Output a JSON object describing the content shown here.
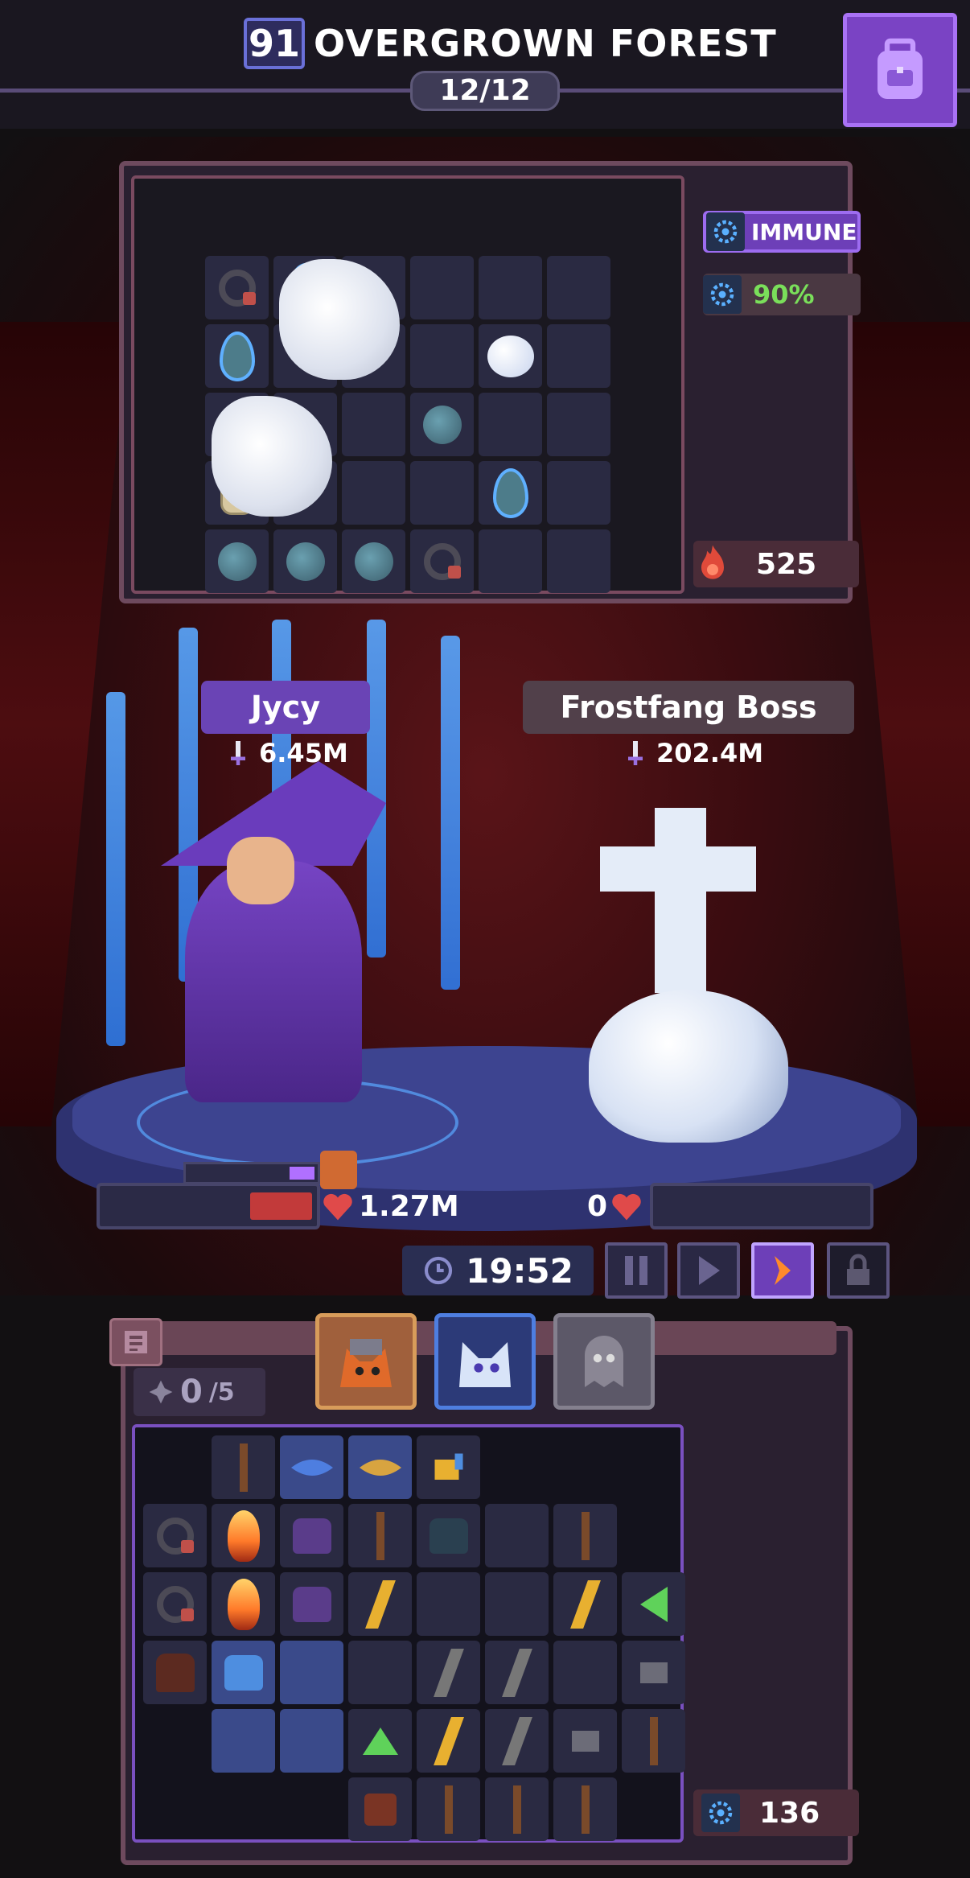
{
  "header": {
    "level": "91",
    "zone_name": "OVERGROWN FOREST",
    "wave": "12/12",
    "bag_icon": "backpack-icon"
  },
  "enemy_panel": {
    "immune_label": "IMMUNE",
    "resist_label": "90%",
    "power_value": "525"
  },
  "player": {
    "name": "Jycy",
    "power": "6.45M",
    "hp": "1.27M",
    "hp_fraction": 0.3,
    "mana_fraction": 0.2
  },
  "boss": {
    "name": "Frostfang Boss",
    "power": "202.4M",
    "hp": "0",
    "hp_fraction": 0
  },
  "controls": {
    "timer": "19:52",
    "pause_icon": "pause-icon",
    "play_icon": "play-icon",
    "fast_forward_icon": "fast-forward-icon",
    "lock_icon": "lock-icon"
  },
  "inventory": {
    "slots_current": "0",
    "slots_max": "/5",
    "power_value": "136",
    "hero_tabs": [
      "fox-warrior-portrait",
      "wolf-mage-portrait",
      "locked-ghost-portrait"
    ]
  },
  "colors": {
    "accent_purple": "#6d3fb8",
    "hp_red": "#c23a3a",
    "resist_green": "#7adf5a",
    "frame_mauve": "#6e4a5e"
  }
}
